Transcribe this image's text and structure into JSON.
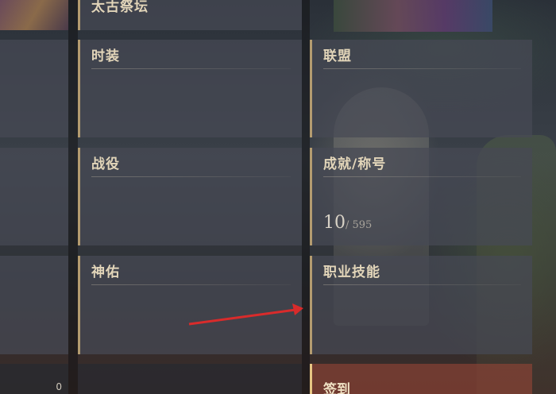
{
  "panels": {
    "ancient_altar": {
      "title": "太古祭坛"
    },
    "fashion": {
      "title": "时装"
    },
    "alliance": {
      "title": "联盟"
    },
    "campaign": {
      "title": "战役"
    },
    "achievement": {
      "title": "成就/称号",
      "current": "10",
      "total": "/ 595"
    },
    "blessing": {
      "title": "神佑"
    },
    "class_skill": {
      "title": "职业技能"
    },
    "sign_in": {
      "title": "签到"
    },
    "bottom_left": {
      "count": "0"
    }
  },
  "colors": {
    "accent_gold": "#b49c70",
    "annotation_arrow": "#d92b2b"
  }
}
